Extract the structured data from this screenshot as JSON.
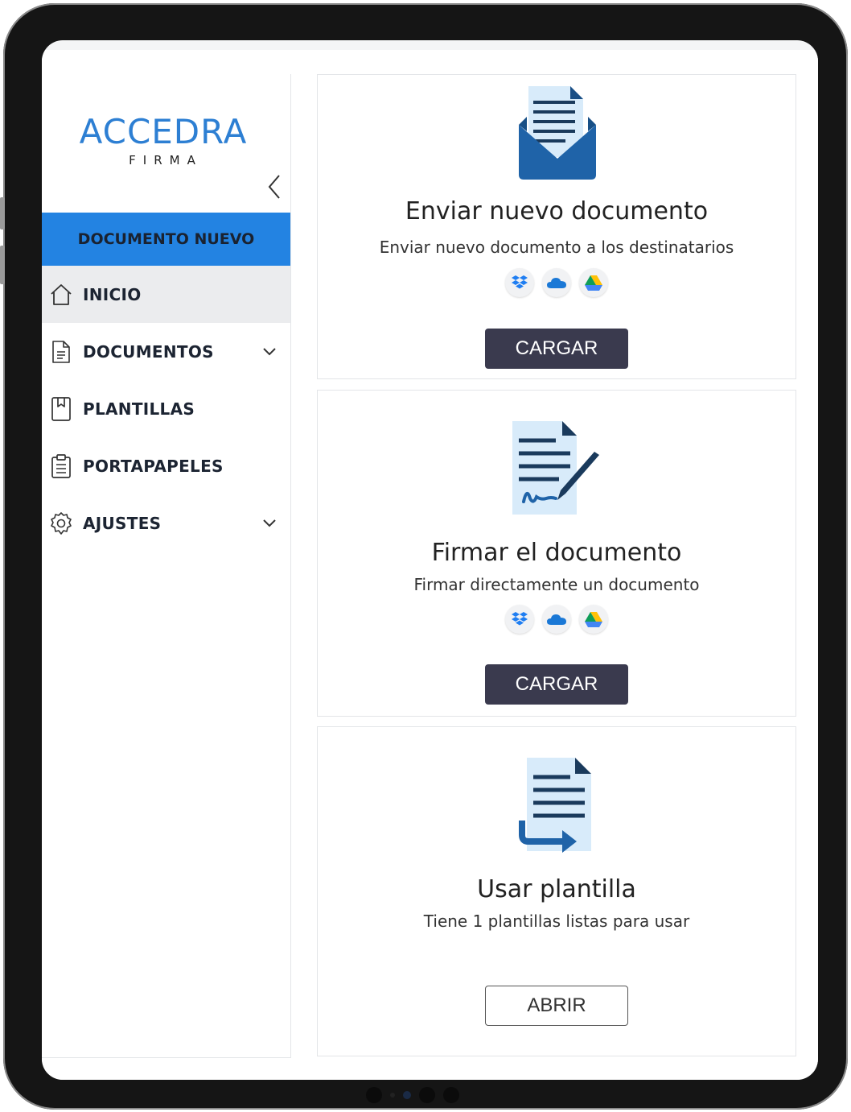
{
  "brand": {
    "name": "ACCEDRA",
    "subtitle": "FIRMA"
  },
  "sidebar": {
    "new_document_label": "DOCUMENTO NUEVO",
    "items": [
      {
        "label": "INICIO",
        "icon": "home-icon",
        "active": true
      },
      {
        "label": "DOCUMENTOS",
        "icon": "document-icon",
        "expandable": true
      },
      {
        "label": "PLANTILLAS",
        "icon": "template-icon"
      },
      {
        "label": "PORTAPAPELES",
        "icon": "clipboard-icon"
      },
      {
        "label": "AJUSTES",
        "icon": "gear-icon",
        "expandable": true
      }
    ]
  },
  "cards": [
    {
      "title": "Enviar nuevo documento",
      "description": "Enviar nuevo documento a los destinatarios",
      "button": "CARGAR",
      "icon": "envelope-document-icon",
      "cloud_sources": [
        "dropbox-icon",
        "onedrive-icon",
        "google-drive-icon"
      ]
    },
    {
      "title": "Firmar el documento",
      "description": "Firmar directamente un documento",
      "button": "CARGAR",
      "icon": "sign-document-icon",
      "cloud_sources": [
        "dropbox-icon",
        "onedrive-icon",
        "google-drive-icon"
      ]
    },
    {
      "title": "Usar plantilla",
      "description": "Tiene 1 plantillas listas para usar",
      "button": "ABRIR",
      "icon": "template-document-icon"
    }
  ],
  "colors": {
    "brand_blue": "#2d7fd3",
    "primary_button": "#2383e2",
    "dark_button": "#3a3a4e",
    "icon_blue": "#1f63a8",
    "icon_light": "#d8ebfa"
  }
}
